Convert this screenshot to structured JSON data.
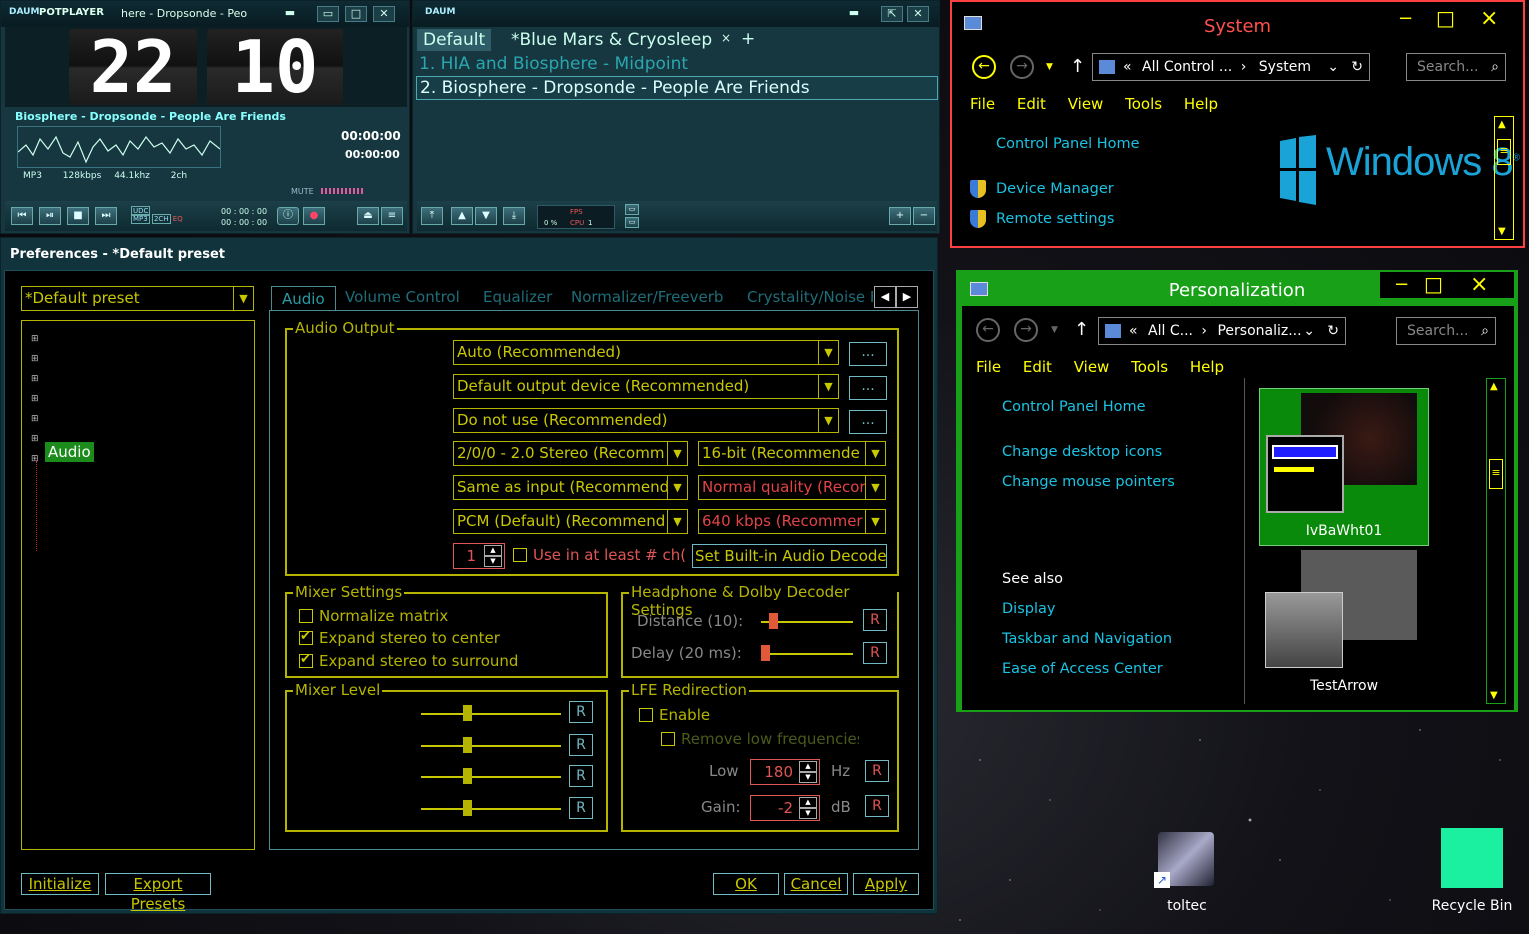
{
  "potplayer": {
    "title": "POTPLAYER",
    "logo": "DAUM",
    "track_title_short": "here - Dropsonde - Peo",
    "hour": "22",
    "minute": "10",
    "now_playing": "Biosphere - Dropsonde - People Are Friends",
    "time1": "00:00:00",
    "time2": "00:00:00",
    "codec": "MP3",
    "bitrate": "128kbps",
    "rate": "44.1khz",
    "channels": "2ch",
    "mute_label": "MUTE",
    "mini_time1": "00 : 00 : 00",
    "mini_time2": "00 : 00 : 00",
    "badge_udp": "UDC",
    "badge_mp3": "MP3",
    "badge_2ch": "2CH",
    "badge_eq": "EQ",
    "fps_label": "FPS",
    "cpu_label": "CPU",
    "fps_value": "0 %",
    "cpu_value": "1"
  },
  "playlist": {
    "logo": "DAUM",
    "tab_default": "Default",
    "tab_blue": "*Blue Mars & Cryosleep",
    "tab_close": "×",
    "tab_add": "+",
    "items": [
      {
        "label": "1. HIA and Biosphere - Midpoint"
      },
      {
        "label": "2. Biosphere - Dropsonde - People Are Friends"
      }
    ]
  },
  "prefs": {
    "title": "Preferences - *Default preset",
    "preset": "*Default preset",
    "tree_selected": "Audio",
    "tabs": [
      "Audio",
      "Volume Control",
      "Equalizer",
      "Normalizer/Freeverb",
      "Crystality/Noise F"
    ],
    "audio_output": {
      "legend": "Audio Output",
      "renderer": "Auto (Recommended)",
      "device": "Default output device (Recommended)",
      "third": "Do not use (Recommended)",
      "speaker": "2/0/0 - 2.0 Stereo (Recomm",
      "bits": "16-bit (Recommende",
      "sample": "Same as input (Recommend",
      "quality": "Normal quality (Recor",
      "pcm": "PCM (Default) (Recommend",
      "kbps": "640 kbps (Recommer",
      "channels_value": "1",
      "use_at_least": "Use in at least # ch(",
      "builtin_decoder": "Set Built-in Audio Decoder",
      "dots": "..."
    },
    "mixer": {
      "legend": "Mixer Settings",
      "normalize": "Normalize matrix",
      "expand_center": "Expand stereo to center",
      "expand_surround": "Expand stereo to surround"
    },
    "headphone": {
      "legend": "Headphone & Dolby Decoder Settings",
      "distance": "Distance (10):",
      "delay": "Delay (20 ms):",
      "r": "R"
    },
    "mixer_level": {
      "legend": "Mixer Level"
    },
    "lfe": {
      "legend": "LFE Redirection",
      "enable": "Enable",
      "remove": "Remove low frequencies",
      "low": "Low",
      "low_value": "180",
      "hz": "Hz",
      "gain": "Gain:",
      "gain_value": "-2",
      "db": "dB"
    },
    "buttons": {
      "initialize": "Initialize",
      "export": "Export Presets",
      "ok": "OK",
      "cancel": "Cancel",
      "apply": "Apply"
    }
  },
  "system": {
    "title": "System",
    "address_prefix": "«",
    "address": "All Control ...",
    "address_arrow": "›",
    "address_current": "System",
    "search": "Search...",
    "menu": [
      "File",
      "Edit",
      "View",
      "Tools",
      "Help"
    ],
    "cp_home": "Control Panel Home",
    "device_manager": "Device Manager",
    "remote_settings": "Remote settings",
    "win8_text": "Windows 8",
    "win8_sup": "®",
    "min": "−",
    "max": "□",
    "close": "×"
  },
  "personalization": {
    "title": "Personalization",
    "address_prefix": "«",
    "address": "All C...",
    "address_arrow": "›",
    "address_current": "Personaliz...",
    "search": "Search...",
    "menu": [
      "File",
      "Edit",
      "View",
      "Tools",
      "Help"
    ],
    "cp_home": "Control Panel Home",
    "desktop_icons": "Change desktop icons",
    "mouse_pointers": "Change mouse pointers",
    "see_also": "See also",
    "display": "Display",
    "taskbar": "Taskbar and Navigation",
    "ease": "Ease of Access Center",
    "theme1": "IvBaWht01",
    "theme2": "TestArrow",
    "min": "−",
    "max": "□",
    "close": "×"
  },
  "desktop": {
    "icon1": "toltec",
    "icon2": "Recycle Bin"
  },
  "colors": {
    "accent_yellow": "#c8c800",
    "pp_bg": "#163640",
    "system_border": "#ff4040",
    "personalization_border": "#18a018",
    "win8_blue": "#1aa3d6"
  }
}
